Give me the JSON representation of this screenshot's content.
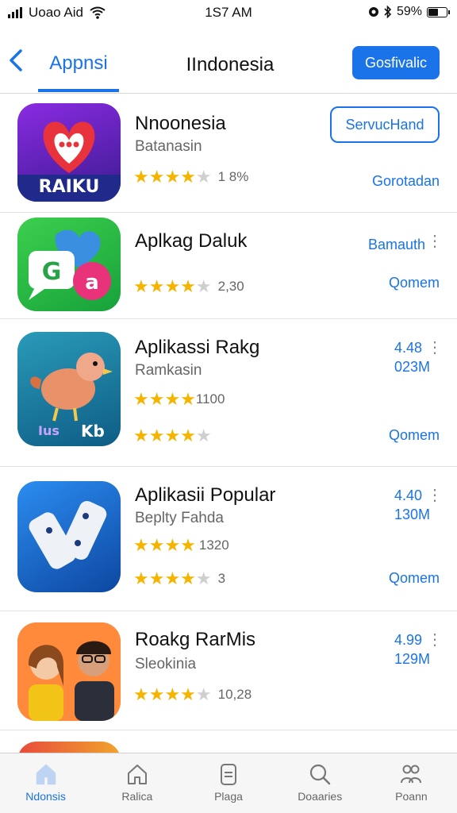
{
  "status": {
    "carrier": "Uoao Aid",
    "time": "1S7 AM",
    "battery": "59%",
    "battery_level": 0.59
  },
  "nav": {
    "back_icon": "chevron-left-icon",
    "tab_label": "Appnsi",
    "title": "IIndonesia",
    "button_label": "Gosfivalic"
  },
  "apps": [
    {
      "name": "Nnoonesia",
      "subtitle": "Batanasin",
      "rating_stars": 4,
      "count": "1 8%",
      "top_button": "ServucHand",
      "action": "Gorotadan"
    },
    {
      "name": "Aplkag Daluk",
      "subtitle": "",
      "rating_stars": 4,
      "count": "2,30",
      "right_top": "Bamauth",
      "action": "Qomem"
    },
    {
      "name": "Aplikassi Rakg",
      "subtitle": "Ramkasin",
      "rating_stars": 4,
      "count": "1100",
      "rating2_stars": 4,
      "right_top": "4.48",
      "right_size": "023M",
      "action": "Qomem"
    },
    {
      "name": "Aplikasii Popular",
      "subtitle": "Beplty Fahda",
      "rating_stars": 4,
      "count": "1320",
      "rating2_stars": 4,
      "count2": "3",
      "right_top": "4.40",
      "right_size": "130M",
      "action": "Qomem"
    },
    {
      "name": "Roakg RarMis",
      "subtitle": "Sleokinia",
      "rating_stars": 4,
      "count": "10,28",
      "right_top": "4.99",
      "right_size": "129M"
    }
  ],
  "tabbar": [
    {
      "label": "Ndonsis",
      "icon": "home-icon"
    },
    {
      "label": "Ralica",
      "icon": "house-icon"
    },
    {
      "label": "Plaga",
      "icon": "document-icon"
    },
    {
      "label": "Doaaries",
      "icon": "search-icon"
    },
    {
      "label": "Poann",
      "icon": "people-icon"
    }
  ]
}
